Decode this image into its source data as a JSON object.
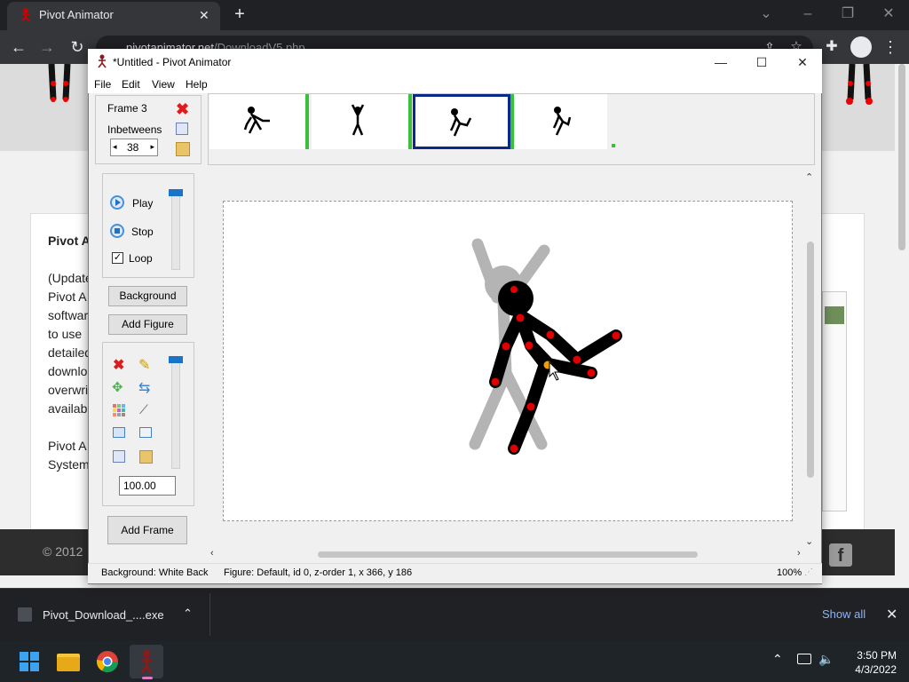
{
  "browser": {
    "tab_title": "Pivot Animator",
    "url_host": "pivotanimator.net",
    "url_path": "/DownloadV5.php"
  },
  "website": {
    "heading": "Pivot A",
    "para1": [
      "(Update",
      "Pivot A",
      "softwar",
      "to use",
      "detailed",
      "downlo",
      "overwri",
      "availab"
    ],
    "para2": [
      "Pivot A",
      "System"
    ],
    "footer": "© 2012"
  },
  "app": {
    "title": "*Untitled - Pivot Animator",
    "menu": [
      "File",
      "Edit",
      "View",
      "Help"
    ],
    "frame_label": "Frame 3",
    "inbetweens_label": "Inbetweens",
    "inbetweens_value": "38",
    "play": "Play",
    "stop": "Stop",
    "loop": "Loop",
    "loop_checked": true,
    "background_btn": "Background",
    "add_figure_btn": "Add Figure",
    "scale_value": "100.00",
    "add_frame_btn": "Add Frame",
    "status_background": "Background: White Back",
    "status_figure": "Figure: Default,  id 0,  z-order 1,  x 366, y 186",
    "status_zoom": "100%",
    "selected_frame": 3,
    "frame_count": 4
  },
  "download": {
    "filename": "Pivot_Download_....exe",
    "show_all": "Show all"
  },
  "taskbar": {
    "time": "3:50 PM",
    "date": "4/3/2022"
  },
  "colors": {
    "joint": "#e00000",
    "selected_frame_border": "#0a2a8a",
    "frame_marker": "#3cbf3c",
    "onion_figure": "#b4b4b4"
  }
}
